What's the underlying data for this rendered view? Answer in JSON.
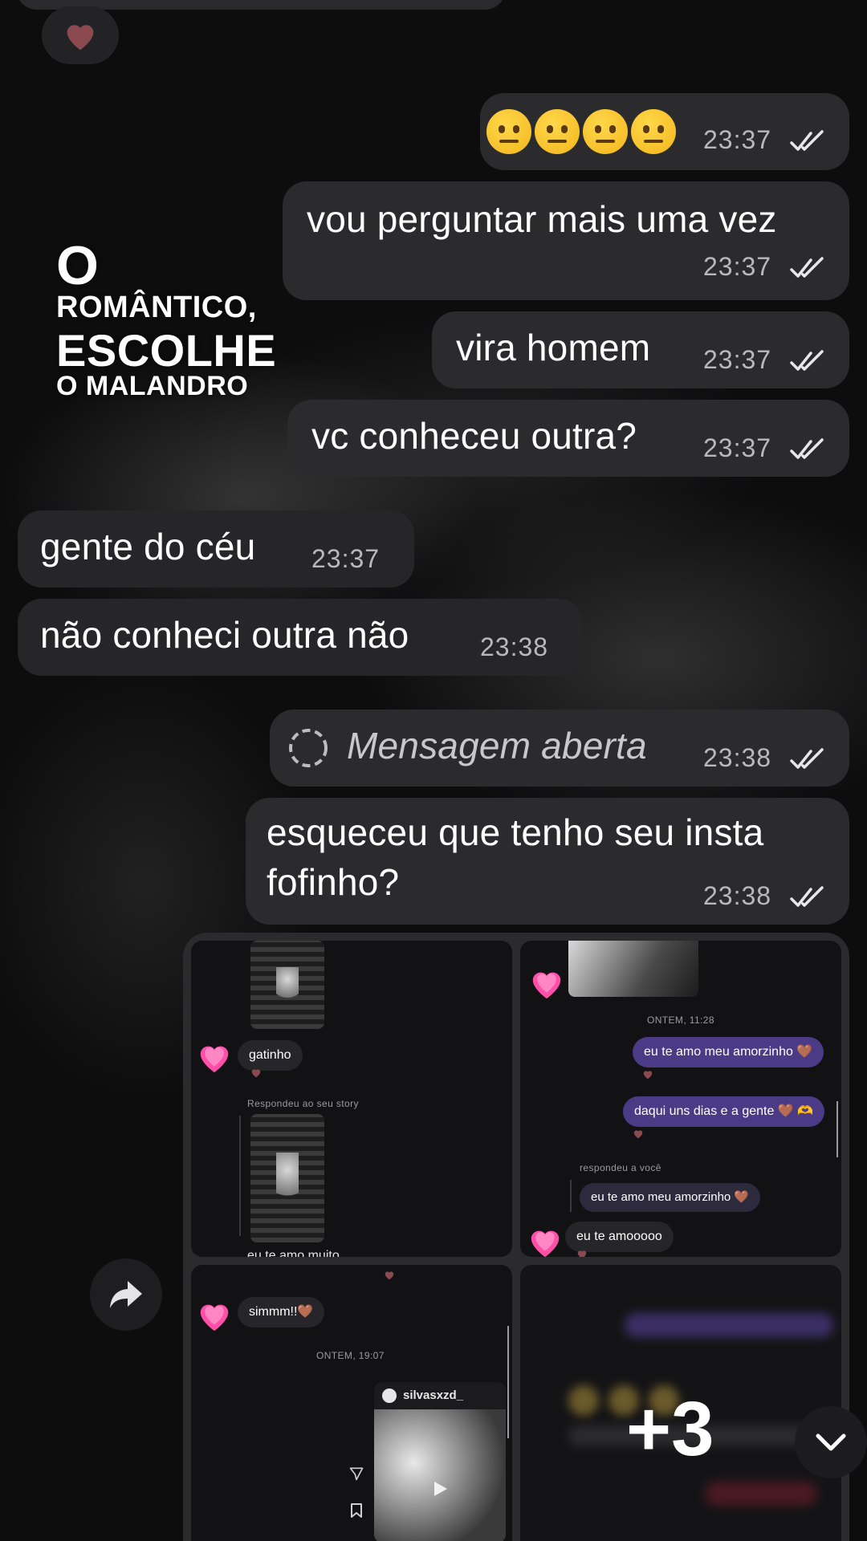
{
  "overlay": {
    "line1": "O",
    "line2": "ROMÂNTICO,",
    "line3": "ESCOLHE",
    "line4": "O MALANDRO"
  },
  "reaction_top": "heart",
  "messages": [
    {
      "id": "m1",
      "direction": "out",
      "text": "🤨🤨🤨🤨",
      "time": "23:37",
      "status": "read"
    },
    {
      "id": "m2",
      "direction": "out",
      "text": "vou perguntar mais uma vez",
      "time": "23:37",
      "status": "read"
    },
    {
      "id": "m3",
      "direction": "out",
      "text": "vira homem",
      "time": "23:37",
      "status": "read"
    },
    {
      "id": "m4",
      "direction": "out",
      "text": "vc conheceu outra?",
      "time": "23:37",
      "status": "read"
    },
    {
      "id": "m5",
      "direction": "in",
      "text": "gente do céu",
      "time": "23:37"
    },
    {
      "id": "m6",
      "direction": "in",
      "text": "não conheci outra não",
      "time": "23:38"
    },
    {
      "id": "m7",
      "direction": "out",
      "text": "Mensagem aberta",
      "time": "23:38",
      "status": "read",
      "type": "view-once-opened"
    },
    {
      "id": "m8",
      "direction": "out",
      "text_line1": "esqueceu que tenho seu insta",
      "text_line2": "fofinho?",
      "time": "23:38",
      "status": "read"
    }
  ],
  "media_grid": {
    "extra_count": "+3",
    "cell1": {
      "message1": "gatinho",
      "story_reply_label": "Respondeu ao seu story",
      "truncated": "eu te amo muito"
    },
    "cell2": {
      "date_label": "ONTEM, 11:28",
      "sent1": "eu te amo meu amorzinho 🤎",
      "sent2": "daqui uns dias e a gente 🤎 🫶",
      "reply_label": "respondeu a você",
      "quoted": "eu te amo meu amorzinho 🤎",
      "received": "eu te amooooo"
    },
    "cell3": {
      "message1": "simmm!!🤎",
      "date_label": "ONTEM, 19:07",
      "post_user": "silvasxzd_"
    }
  },
  "colors": {
    "bubble_out": "#2b2b2d",
    "bubble_in": "#262628",
    "pill_purple": "#4b3a86",
    "heart_pink": "#ff4fa8"
  }
}
